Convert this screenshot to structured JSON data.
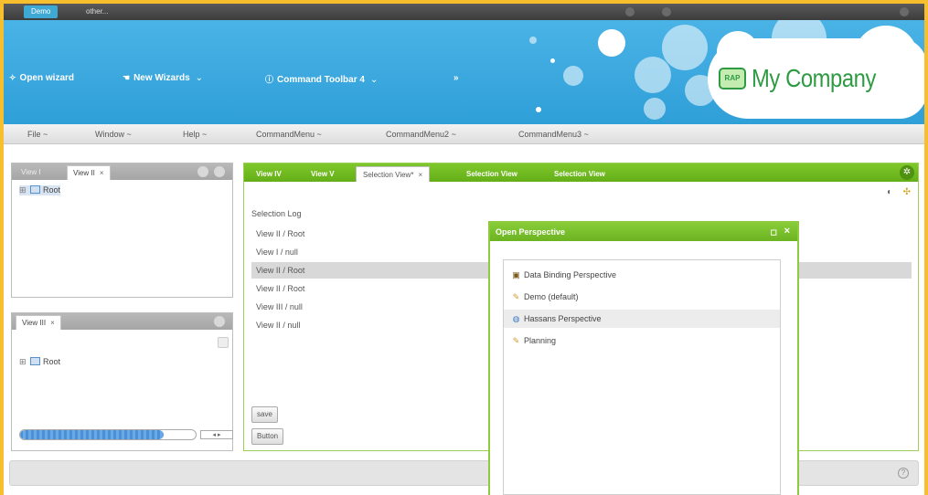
{
  "perspective_switcher": {
    "active": "Demo",
    "other": "other..."
  },
  "banner": {
    "toolbar": {
      "open_wizard": "Open wizard",
      "new_wizards": "New Wizards",
      "command_toolbar": "Command Toolbar 4",
      "more": "»"
    },
    "logo": {
      "badge": "RAP",
      "text": "My Company"
    },
    "brand_color": "#2e9b43",
    "banner_color": "#3aa8e0"
  },
  "menubar": {
    "items": [
      "File",
      "Window",
      "Help",
      "CommandMenu",
      "CommandMenu2",
      "CommandMenu3"
    ],
    "caret": "~"
  },
  "left_top_pane": {
    "tabs": [
      "View I",
      "View II"
    ],
    "close": "×",
    "tree": {
      "expander": "⊞",
      "label": "Root"
    }
  },
  "left_bottom_pane": {
    "tab": "View III",
    "close": "×",
    "tree": {
      "expander": "⊞",
      "label": "Root"
    },
    "progress": 0.82,
    "arrows": "◂ ▸"
  },
  "main": {
    "tabs": [
      "View IV",
      "View V",
      "Selection View*",
      "Selection View",
      "Selection View"
    ],
    "close": "×",
    "log_title": "Selection Log",
    "log": [
      "View II / Root",
      "View I / null",
      "View II / Root",
      "View II / Root",
      "View III / null",
      "View II / null"
    ],
    "selected_row": 2,
    "buttons": {
      "save": "save",
      "button": "Button"
    }
  },
  "dialog": {
    "title": "Open Perspective",
    "items": [
      {
        "label": "Data Binding Perspective",
        "icon": "binding-icon"
      },
      {
        "label": "Demo (default)",
        "icon": "pencil-icon"
      },
      {
        "label": "Hassans Perspective",
        "icon": "globe-icon"
      },
      {
        "label": "Planning",
        "icon": "pencil-icon"
      }
    ],
    "highlighted": 2,
    "accent": "#7dc22c"
  },
  "statusbar": {
    "help": "?"
  }
}
